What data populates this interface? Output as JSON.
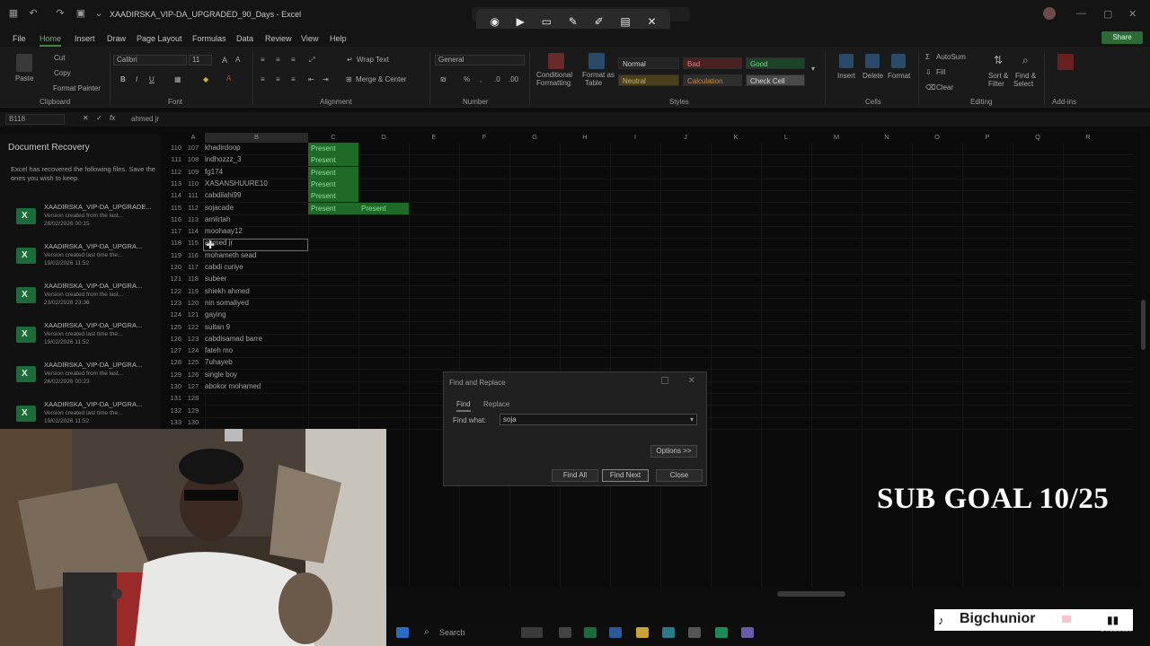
{
  "window": {
    "title": "XAADIRSKA_VIP-DA_UPGRADED_90_Days - Excel"
  },
  "snip_toolbar": {
    "icons": [
      "camera-icon",
      "video-icon",
      "rectangle-select-icon",
      "edit-pen-icon",
      "highlighter-icon",
      "text-scan-icon",
      "close-icon"
    ]
  },
  "menu": {
    "items": [
      "File",
      "Home",
      "Insert",
      "Draw",
      "Page Layout",
      "Formulas",
      "Data",
      "Review",
      "View",
      "Help"
    ],
    "active": "Home",
    "share_label": "Share"
  },
  "ribbon": {
    "clipboard": {
      "paste": "Paste",
      "cut": "Cut",
      "copy": "Copy",
      "format_painter": "Format Painter",
      "label": "Clipboard"
    },
    "font": {
      "name": "Calibri",
      "size": "11",
      "label": "Font"
    },
    "alignment": {
      "wrap": "Wrap Text",
      "merge": "Merge & Center",
      "label": "Alignment"
    },
    "number": {
      "format": "General",
      "label": "Number"
    },
    "styles": {
      "cond_format_1": "Conditional",
      "cond_format_2": "Formatting",
      "format_table_1": "Format as",
      "format_table_2": "Table",
      "normal": "Normal",
      "bad": "Bad",
      "good": "Good",
      "neutral": "Neutral",
      "calculation": "Calculation",
      "check_cell": "Check Cell",
      "label": "Styles"
    },
    "cells": {
      "insert": "Insert",
      "delete": "Delete",
      "format": "Format",
      "label": "Cells"
    },
    "editing": {
      "autosum": "AutoSum",
      "fill": "Fill",
      "clear": "Clear",
      "sort_1": "Sort &",
      "sort_2": "Filter",
      "find_1": "Find &",
      "find_2": "Select",
      "label": "Editing"
    },
    "addins": {
      "label": "Add-ins"
    }
  },
  "formula_bar": {
    "name_box": "B118",
    "content": "ahmed jr"
  },
  "recovery": {
    "title": "Document Recovery",
    "desc": "Excel has recovered the following files. Save the ones you wish to keep.",
    "items": [
      {
        "name": "XAADIRSKA_VIP-DA_UPGRADE...",
        "sub": "Version created from the last...",
        "date": "28/02/2026 00:15"
      },
      {
        "name": "XAADIRSKA_VIP-DA_UPGRA...",
        "sub": "Version created last time the...",
        "date": "19/02/2026 11:52"
      },
      {
        "name": "XAADIRSKA_VIP-DA_UPGRA...",
        "sub": "Version created from the last...",
        "date": "23/02/2026 23:36"
      },
      {
        "name": "XAADIRSKA_VIP-DA_UPGRA...",
        "sub": "Version created last time the...",
        "date": "19/02/2026 11:52"
      },
      {
        "name": "XAADIRSKA_VIP-DA_UPGRA...",
        "sub": "Version created from the last...",
        "date": "26/02/2026 00:23"
      },
      {
        "name": "XAADIRSKA_VIP-DA_UPGRA...",
        "sub": "Version created last time the...",
        "date": "19/02/2026 11:52"
      }
    ]
  },
  "columns": [
    "A",
    "B",
    "C",
    "D",
    "E",
    "F",
    "G",
    "H",
    "I",
    "J",
    "K",
    "L",
    "M",
    "N",
    "O",
    "P",
    "Q",
    "R"
  ],
  "rows": [
    {
      "row": "110",
      "a": "107",
      "b": "khadirdoop",
      "c": "Present",
      "d": ""
    },
    {
      "row": "111",
      "a": "108",
      "b": "indhozzz_3",
      "c": "Present",
      "d": ""
    },
    {
      "row": "112",
      "a": "109",
      "b": "fg174",
      "c": "Present",
      "d": ""
    },
    {
      "row": "113",
      "a": "110",
      "b": "XASANSHUURE10",
      "c": "Present",
      "d": ""
    },
    {
      "row": "114",
      "a": "111",
      "b": "cabdilahi99",
      "c": "Present",
      "d": ""
    },
    {
      "row": "115",
      "a": "112",
      "b": "sojacade",
      "c": "Present",
      "d": "Present"
    },
    {
      "row": "116",
      "a": "113",
      "b": "amiirtah",
      "c": "",
      "d": ""
    },
    {
      "row": "117",
      "a": "114",
      "b": "moohaay12",
      "c": "",
      "d": ""
    },
    {
      "row": "118",
      "a": "115",
      "b": "ahmed jr",
      "c": "",
      "d": ""
    },
    {
      "row": "119",
      "a": "116",
      "b": "mohameth sead",
      "c": "",
      "d": ""
    },
    {
      "row": "120",
      "a": "117",
      "b": "cabdi curiye",
      "c": "",
      "d": ""
    },
    {
      "row": "121",
      "a": "118",
      "b": "subeer",
      "c": "",
      "d": ""
    },
    {
      "row": "122",
      "a": "119",
      "b": "shiekh ahmed",
      "c": "",
      "d": ""
    },
    {
      "row": "123",
      "a": "120",
      "b": "nin somaliyed",
      "c": "",
      "d": ""
    },
    {
      "row": "124",
      "a": "121",
      "b": "gaying",
      "c": "",
      "d": ""
    },
    {
      "row": "125",
      "a": "122",
      "b": "sultan 9",
      "c": "",
      "d": ""
    },
    {
      "row": "126",
      "a": "123",
      "b": "cabdisamad barre",
      "c": "",
      "d": ""
    },
    {
      "row": "127",
      "a": "124",
      "b": "fateh mo",
      "c": "",
      "d": ""
    },
    {
      "row": "128",
      "a": "125",
      "b": "7uhayeb",
      "c": "",
      "d": ""
    },
    {
      "row": "129",
      "a": "126",
      "b": "single boy",
      "c": "",
      "d": ""
    },
    {
      "row": "130",
      "a": "127",
      "b": "abokor mohamed",
      "c": "",
      "d": ""
    },
    {
      "row": "131",
      "a": "128",
      "b": "",
      "c": "",
      "d": ""
    },
    {
      "row": "132",
      "a": "129",
      "b": "",
      "c": "",
      "d": ""
    },
    {
      "row": "133",
      "a": "130",
      "b": "",
      "c": "",
      "d": ""
    }
  ],
  "dialog": {
    "title": "Find and Replace",
    "tab_find": "Find",
    "tab_replace": "Replace",
    "find_label": "Find what:",
    "find_value": "soja",
    "options": "Options >>",
    "find_all": "Find All",
    "find_next": "Find Next",
    "close": "Close"
  },
  "overlay": {
    "sub_goal": "SUB GOAL 10/25",
    "tiktok_name": "Bigchunior"
  },
  "taskbar": {
    "search": "Search"
  },
  "clock": {
    "time": "",
    "date": "14/03/2026"
  },
  "colors": {
    "present_bg": "#1f6a28",
    "present_text": "#8fe09a",
    "accent": "#3f8a3f"
  }
}
